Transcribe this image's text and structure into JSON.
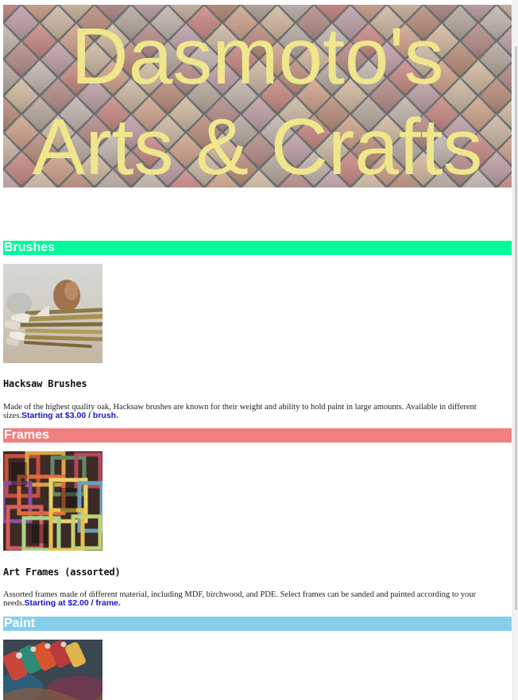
{
  "header": {
    "title": "Dasmoto's Arts & Crafts",
    "title_color": "#F0E68C"
  },
  "sections": [
    {
      "title": "Brushes",
      "color": "#00FA9A",
      "item_name": "Hacksaw Brushes",
      "description": "Made of the highest quality oak, Hacksaw brushes are known for their weight and ability to hold paint in large amounts. Available in different sizes.",
      "price": "Starting at $3.00 / brush.",
      "image": "brushes-photo"
    },
    {
      "title": "Frames",
      "color": "#F08080",
      "item_name": "Art Frames (assorted)",
      "description": "Assorted frames made of different material, including MDF, birchwood, and PDE. Select frames can be sanded and painted according to your needs.",
      "price": "Starting at $2.00 / frame.",
      "image": "frames-photo"
    },
    {
      "title": "Paint",
      "color": "#87CEEB",
      "image": "paint-photo"
    }
  ],
  "colors": {
    "price_text": "#1515C8",
    "body_text": "#222222"
  }
}
